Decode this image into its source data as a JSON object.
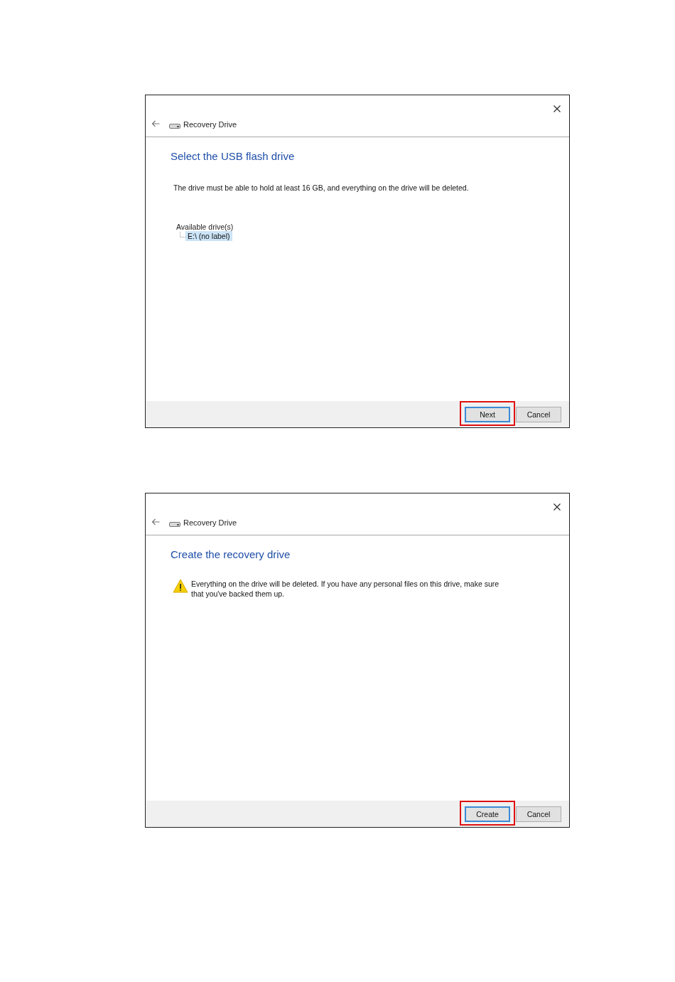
{
  "dialogs": [
    {
      "kind": "select",
      "title": "Recovery Drive",
      "heading": "Select the USB flash drive",
      "message": "The drive must be able to hold at least 16 GB, and everything on the drive will be deleted.",
      "list_label": "Available drive(s)",
      "drives": [
        {
          "label": "E:\\ (no label)",
          "selected": true
        }
      ],
      "buttons": [
        {
          "label": "Next",
          "default": true,
          "highlighted": true
        },
        {
          "label": "Cancel",
          "default": false,
          "highlighted": false
        }
      ]
    },
    {
      "kind": "warning",
      "title": "Recovery Drive",
      "heading": "Create the recovery drive",
      "message": "Everything on the drive will be deleted. If you have any personal files on this drive, make sure that you've backed them up.",
      "buttons": [
        {
          "label": "Create",
          "default": true,
          "highlighted": true
        },
        {
          "label": "Cancel",
          "default": false,
          "highlighted": false
        }
      ]
    }
  ]
}
